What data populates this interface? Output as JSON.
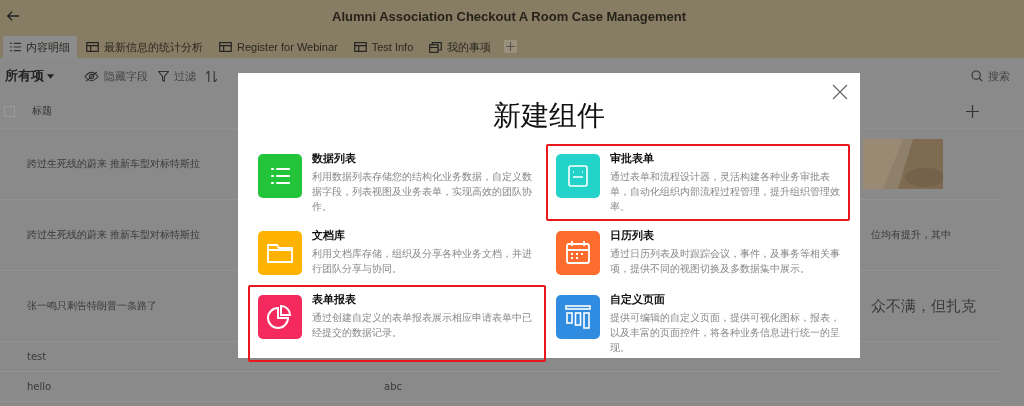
{
  "header": {
    "title": "Alumni Association Checkout A Room Case Management"
  },
  "tabs": [
    {
      "label": "内容明细",
      "selected": true
    },
    {
      "label": "最新信息的统计分析",
      "selected": false
    },
    {
      "label": "Register for Webinar",
      "selected": false
    },
    {
      "label": "Test Info",
      "selected": false
    },
    {
      "label": "我的事项",
      "selected": false
    }
  ],
  "toolbar": {
    "view": "所有项",
    "hide_fields": "隐藏字段",
    "filter": "过滤",
    "search": "搜索"
  },
  "table": {
    "columns": [
      "标题"
    ],
    "select_all_checked": false,
    "rows": [
      {
        "title": "跨过生死线的蔚来 推新车型对标特斯拉",
        "column_3": "",
        "kind": "picture"
      },
      {
        "title": "跨过生死线的蔚来 推新车型对标特斯拉",
        "column_3": "位均有提升，其中",
        "kind": "small"
      },
      {
        "title": "张一鸣只剩告特朗普一条路了",
        "column_3": "众不满，但扎克",
        "kind": "large"
      },
      {
        "title": "test",
        "column_2": "",
        "kind": "short"
      },
      {
        "title": "hello",
        "column_2": "abc",
        "kind": "short"
      }
    ]
  },
  "dialog": {
    "title": "新建组件",
    "items": [
      {
        "name": "数据列表",
        "description": "利用数据列表存储您的结构化业务数据，自定义数据字段，列表视图及业务表单，实现高效的团队协作。",
        "color": "#22c43a",
        "highlighted": false
      },
      {
        "name": "审批表单",
        "description": "通过表单和流程设计器，灵活构建各种业务审批表单，自动化组织内部流程过程管理，提升组织管理效率。",
        "color": "#23d3c9",
        "highlighted": true
      },
      {
        "name": "文档库",
        "description": "利用文档库存储，组织及分享各种业务文档，并进行团队分享与协同。",
        "color": "#ffb300",
        "highlighted": false
      },
      {
        "name": "日历列表",
        "description": "通过日历列表及时跟踪会议，事件，及事务等相关事项，提供不同的视图切换及多数据集中展示。",
        "color": "#ff6d2e",
        "highlighted": false
      },
      {
        "name": "表单报表",
        "description": "通过创建自定义的表单报表展示相应申请表单中已经提交的数据记录。",
        "color": "#f42a5e",
        "highlighted": true
      },
      {
        "name": "自定义页面",
        "description": "提供可编辑的自定义页面，提供可视化图标，报表，以及丰富的页面控件，将各种业务信息进行统一的呈现。",
        "color": "#2f8ce0",
        "highlighted": false
      }
    ]
  }
}
